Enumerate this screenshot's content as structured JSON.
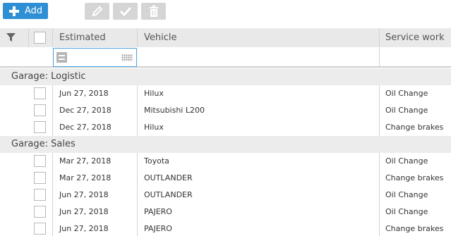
{
  "toolbar": {
    "add_label": "Add"
  },
  "columns": {
    "estimated": "Estimated",
    "vehicle": "Vehicle",
    "service_work": "Service work"
  },
  "groups": [
    {
      "label": "Garage: Logistic",
      "rows": [
        {
          "estimated": "Jun 27, 2018",
          "vehicle": "Hilux",
          "service": "Oil Change"
        },
        {
          "estimated": "Dec 27, 2018",
          "vehicle": "Mitsubishi L200",
          "service": "Oil Change"
        },
        {
          "estimated": "Dec 27, 2018",
          "vehicle": "Hilux",
          "service": "Change brakes"
        }
      ]
    },
    {
      "label": "Garage: Sales",
      "rows": [
        {
          "estimated": "Mar 27, 2018",
          "vehicle": "Toyota",
          "service": "Oil Change"
        },
        {
          "estimated": "Mar 27, 2018",
          "vehicle": "OUTLANDER",
          "service": "Change brakes"
        },
        {
          "estimated": "Jun 27, 2018",
          "vehicle": "OUTLANDER",
          "service": "Oil Change"
        },
        {
          "estimated": "Jun 27, 2018",
          "vehicle": "PAJERO",
          "service": "Oil Change"
        },
        {
          "estimated": "Jun 27, 2018",
          "vehicle": "PAJERO",
          "service": "Change brakes"
        }
      ]
    }
  ]
}
